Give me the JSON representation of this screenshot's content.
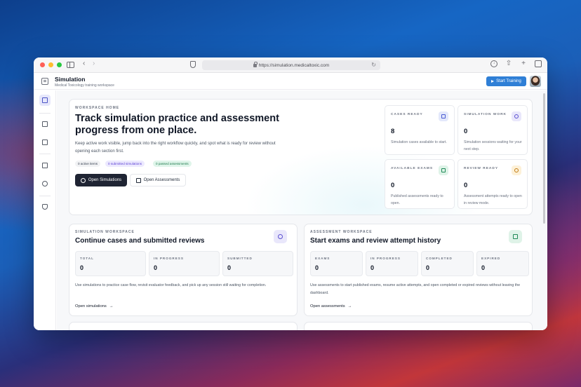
{
  "browser": {
    "url": "https://simulation.medicaltoxic.com"
  },
  "app": {
    "title": "Simulation",
    "subtitle": "Medical Toxicology training workspace",
    "start_button": "Start Training"
  },
  "hero": {
    "eyebrow": "WORKSPACE HOME",
    "title": "Track simulation practice and assessment progress from one place.",
    "description": "Keep active work visible, jump back into the right workflow quickly, and spot what is ready for review without opening each section first.",
    "pills": [
      "0 active items",
      "0 submitted simulations",
      "0 passed assessments"
    ],
    "primary_button": "Open Simulations",
    "secondary_button": "Open Assessments"
  },
  "stats": [
    {
      "label": "CASES READY",
      "value": "8",
      "desc": "Simulation cases available to start.",
      "icon": "folder-icon"
    },
    {
      "label": "SIMULATION WORK",
      "value": "0",
      "desc": "Simulation sessions waiting for your next step.",
      "icon": "target-icon"
    },
    {
      "label": "AVAILABLE EXAMS",
      "value": "0",
      "desc": "Published assessments ready to open.",
      "icon": "grid-icon"
    },
    {
      "label": "REVIEW READY",
      "value": "0",
      "desc": "Assessment attempts ready to open in review mode.",
      "icon": "clock-icon"
    }
  ],
  "sim_panel": {
    "eyebrow": "SIMULATION WORKSPACE",
    "title": "Continue cases and submitted reviews",
    "minis": [
      {
        "label": "TOTAL",
        "value": "0"
      },
      {
        "label": "IN PROGRESS",
        "value": "0"
      },
      {
        "label": "SUBMITTED",
        "value": "0"
      }
    ],
    "description": "Use simulations to practice case flow, revisit evaluator feedback, and pick up any session still waiting for completion.",
    "link": "Open simulations"
  },
  "assess_panel": {
    "eyebrow": "ASSESSMENT WORKSPACE",
    "title": "Start exams and review attempt history",
    "minis": [
      {
        "label": "EXAMS",
        "value": "0"
      },
      {
        "label": "IN PROGRESS",
        "value": "0"
      },
      {
        "label": "COMPLETED",
        "value": "0"
      },
      {
        "label": "EXPIRED",
        "value": "0"
      }
    ],
    "description": "Use assessments to start published exams, resume active attempts, and open completed or expired reviews without leaving the dashboard.",
    "link": "Open assessments"
  },
  "arrow_glyph": "→"
}
